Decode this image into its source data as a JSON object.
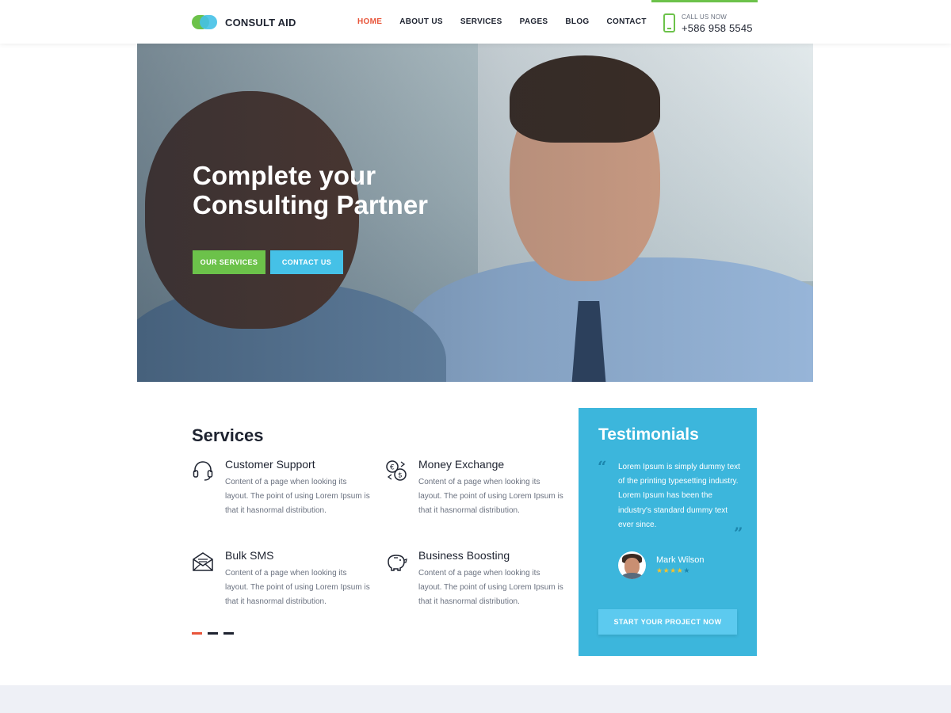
{
  "header": {
    "logo_text": "CONSULT AID",
    "nav": [
      {
        "label": "HOME",
        "active": true
      },
      {
        "label": "ABOUT US"
      },
      {
        "label": "SERVICES"
      },
      {
        "label": "PAGES"
      },
      {
        "label": "BLOG"
      },
      {
        "label": "CONTACT"
      }
    ],
    "call_label": "CALL US NOW",
    "call_phone": "+586 958 5545"
  },
  "hero": {
    "title_line1": "Complete your",
    "title_line2": "Consulting Partner",
    "btn_services": "OUR SERVICES",
    "btn_contact": "CONTACT US"
  },
  "services": {
    "title": "Services",
    "items": [
      {
        "icon": "headset-icon",
        "title": "Customer Support",
        "desc": "Content of a page when looking its layout. The point of using Lorem Ipsum is that it hasnormal distribution."
      },
      {
        "icon": "money-exchange-icon",
        "title": "Money Exchange",
        "desc": "Content of a page when looking its layout. The point of using Lorem Ipsum is that it hasnormal distribution."
      },
      {
        "icon": "envelope-icon",
        "title": "Bulk SMS",
        "desc": "Content of a page when looking its layout. The point of using Lorem Ipsum is that it hasnormal distribution."
      },
      {
        "icon": "piggy-bank-icon",
        "title": "Business Boosting",
        "desc": "Content of a page when looking its layout. The point of using Lorem Ipsum is that it hasnormal distribution."
      }
    ]
  },
  "testimonials": {
    "title": "Testimonials",
    "quote": "Lorem Ipsum is simply dummy text of the printing typesetting industry. Lorem Ipsum has been the industry's standard dummy text ever since.",
    "author": "Mark Wilson",
    "rating": 4,
    "rating_max": 5,
    "cta": "START YOUR PROJECT NOW"
  },
  "colors": {
    "green": "#6cc24a",
    "blue": "#45c1e7",
    "accent_red": "#e8553a",
    "testimonial_bg": "#3cb6dc"
  }
}
